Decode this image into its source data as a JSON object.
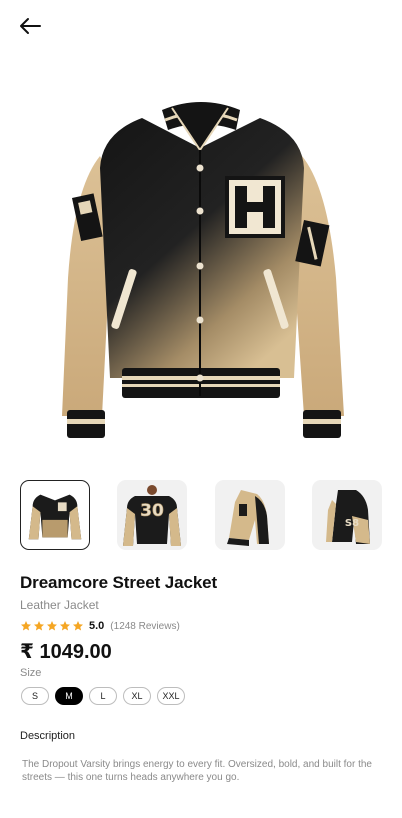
{
  "header": {
    "back_icon": "arrow-left-icon"
  },
  "product": {
    "title": "Dreamcore Street Jacket",
    "category": "Leather Jacket",
    "rating": "5.0",
    "stars": 5,
    "reviews": "(1248 Reviews)",
    "price": "₹ 1049.00",
    "size_label": "Size",
    "sizes": [
      "S",
      "M",
      "L",
      "XL",
      "XXL"
    ],
    "selected_size": "M",
    "description_label": "Description",
    "description": "The Dropout Varsity brings energy to every fit. Oversized, bold, and built for the streets — this one turns heads anywhere you go."
  },
  "gallery": {
    "selected_index": 0,
    "thumb_patch_text": [
      "30",
      "S8"
    ]
  },
  "colors": {
    "accent": "#000000",
    "star": "#f5a623",
    "muted": "#8a8a8a",
    "tan": "#d9bd8f"
  }
}
